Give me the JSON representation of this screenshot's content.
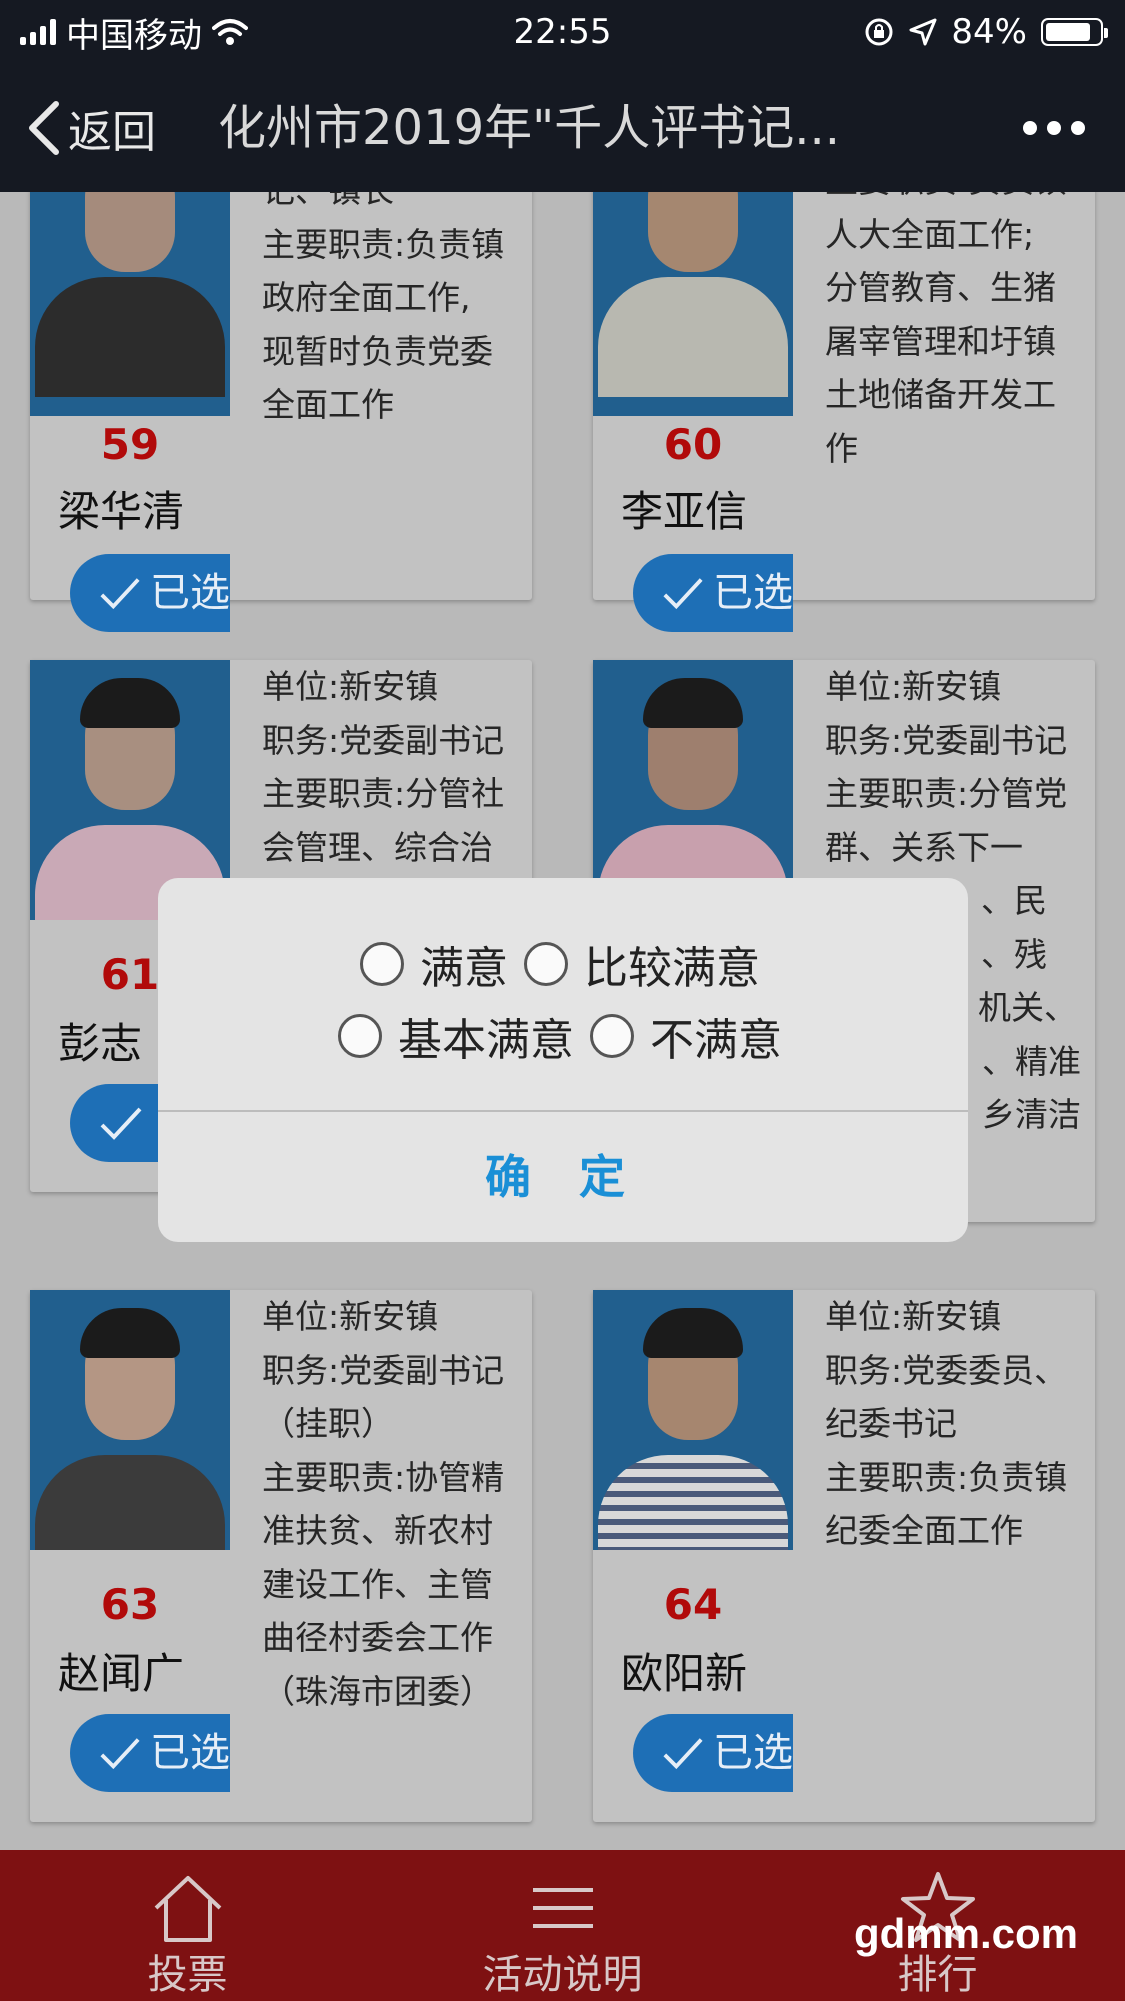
{
  "status_bar": {
    "carrier": "中国移动",
    "time": "22:55",
    "battery_percent": "84%",
    "battery_level": 0.84
  },
  "nav": {
    "back_label": "返回",
    "title": "化州市2019年\"千人评书记..."
  },
  "candidates": [
    {
      "number": "59",
      "name": "梁华清",
      "voted_label": "已选",
      "info": [
        "记、镇长",
        "主要职责:负责镇",
        "政府全面工作,",
        "现暂时负责党委",
        "全面工作"
      ]
    },
    {
      "number": "60",
      "name": "李亚信",
      "voted_label": "已选",
      "info": [
        "主要职责:负责镇",
        "人大全面工作;",
        "分管教育、生猪",
        "屠宰管理和圩镇",
        "土地储备开发工",
        "作"
      ]
    },
    {
      "number": "61",
      "name": "彭志",
      "voted_label": "",
      "info": [
        "单位:新安镇",
        "职务:党委副书记",
        "主要职责:分管社",
        "会管理、综合治"
      ]
    },
    {
      "number": "",
      "name": "",
      "voted_label": "",
      "info": [
        "单位:新安镇",
        "职务:党委副书记",
        "主要职责:分管党",
        "群、关系下一",
        "、民",
        "、残",
        "机关、",
        "、精准",
        "乡清洁"
      ]
    },
    {
      "number": "63",
      "name": "赵闻广",
      "voted_label": "已选",
      "info": [
        "单位:新安镇",
        "职务:党委副书记",
        "（挂职）",
        "主要职责:协管精",
        "准扶贫、新农村",
        "建设工作、主管",
        "曲径村委会工作",
        "（珠海市团委）"
      ]
    },
    {
      "number": "64",
      "name": "欧阳新",
      "voted_label": "已选",
      "info": [
        "单位:新安镇",
        "职务:党委委员、",
        "纪委书记",
        "主要职责:负责镇",
        "纪委全面工作"
      ]
    }
  ],
  "dialog": {
    "options": [
      "满意",
      "比较满意",
      "基本满意",
      "不满意"
    ],
    "confirm_label": "确 定"
  },
  "tabbar": {
    "tabs": [
      "投票",
      "活动说明",
      "排行"
    ]
  },
  "watermark": "gdmm.com"
}
